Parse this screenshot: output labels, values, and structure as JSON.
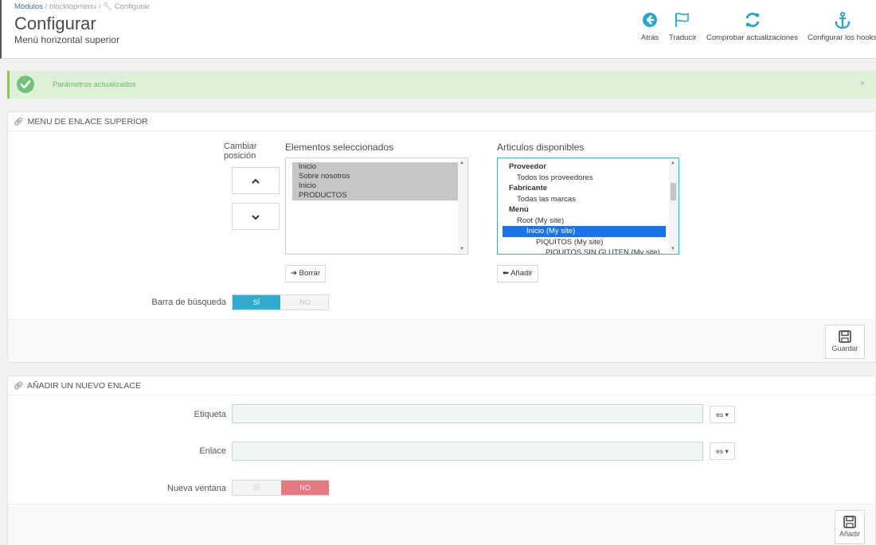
{
  "breadcrumb": {
    "item1": "Módulos",
    "item2": "blocktopmenu",
    "item3": "Configurar",
    "sep": "/"
  },
  "header": {
    "title": "Configurar",
    "subtitle": "Menú horizontal superior"
  },
  "toolbar": [
    {
      "label": "Atrás",
      "icon": "arrow-left-circle-icon"
    },
    {
      "label": "Traducir",
      "icon": "flag-icon"
    },
    {
      "label": "Comprobar actualizaciones",
      "icon": "refresh-icon"
    },
    {
      "label": "Configurar los hooks",
      "icon": "anchor-icon"
    }
  ],
  "alert": {
    "text": "Parámetros actualizados",
    "close": "×",
    "color": "#72c279"
  },
  "menu_panel": {
    "heading": "MENU DE ENLACE SUPERIOR",
    "position_label_line1": "Cambiar",
    "position_label_line2": "posición",
    "selected_heading": "Elementos seleccionados",
    "selected_items": [
      "Inicio",
      "Sobre nosotros",
      "Inicio",
      "PRODUCTOS"
    ],
    "available_heading": "Articulos disponibles",
    "available_items": [
      {
        "text": "Proveedor",
        "kind": "group"
      },
      {
        "text": "Todos los proveedores",
        "kind": "item"
      },
      {
        "text": "Fabricante",
        "kind": "group"
      },
      {
        "text": "Todas las marcas",
        "kind": "item"
      },
      {
        "text": "Menú",
        "kind": "group"
      },
      {
        "text": "Root (My site)",
        "kind": "item"
      },
      {
        "text": "Inicio (My site)",
        "kind": "active"
      },
      {
        "text": "PIQUITOS (My site)",
        "kind": "item"
      },
      {
        "text": "PIQUITOS SIN GLUTEN (My site)",
        "kind": "item"
      }
    ],
    "remove_label": "Borrar",
    "add_label": "Añadir",
    "search_bar_label": "Barra de búsqueda",
    "switch_yes": "SÍ",
    "switch_no": "NO",
    "search_bar_value": "SÍ",
    "save_label": "Guardar"
  },
  "link_panel": {
    "heading": "AÑADIR UN NUEVO ENLACE",
    "label_field": "Etiqueta",
    "label_value": "",
    "link_field": "Enlace",
    "link_value": "",
    "lang": "es",
    "new_window_label": "Nueva ventana",
    "switch_yes": "SÍ",
    "switch_no": "NO",
    "new_window_value": "NO",
    "add_label": "Añadir"
  },
  "colors": {
    "accent_blue": "#2eacce",
    "danger": "#e57b82",
    "success_bg": "#dff0d8",
    "toolbar_icon": "#2ba6cb"
  }
}
